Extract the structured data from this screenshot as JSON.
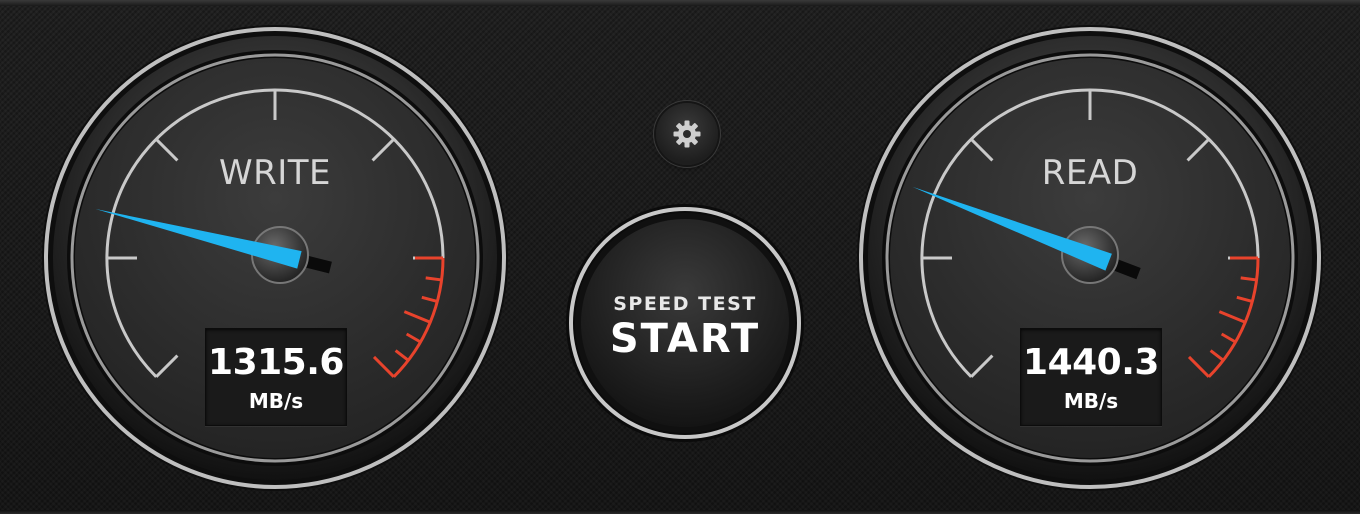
{
  "write_gauge": {
    "label": "WRITE",
    "value": "1315.6",
    "unit": "MB/s",
    "needle_color": "#1fb4f0",
    "redline_color": "#e8432c"
  },
  "read_gauge": {
    "label": "READ",
    "value": "1440.3",
    "unit": "MB/s",
    "needle_color": "#1fb4f0",
    "redline_color": "#e8432c"
  },
  "start_button": {
    "subtitle": "SPEED TEST",
    "label": "START"
  },
  "settings_button": {
    "icon": "gear-icon"
  }
}
